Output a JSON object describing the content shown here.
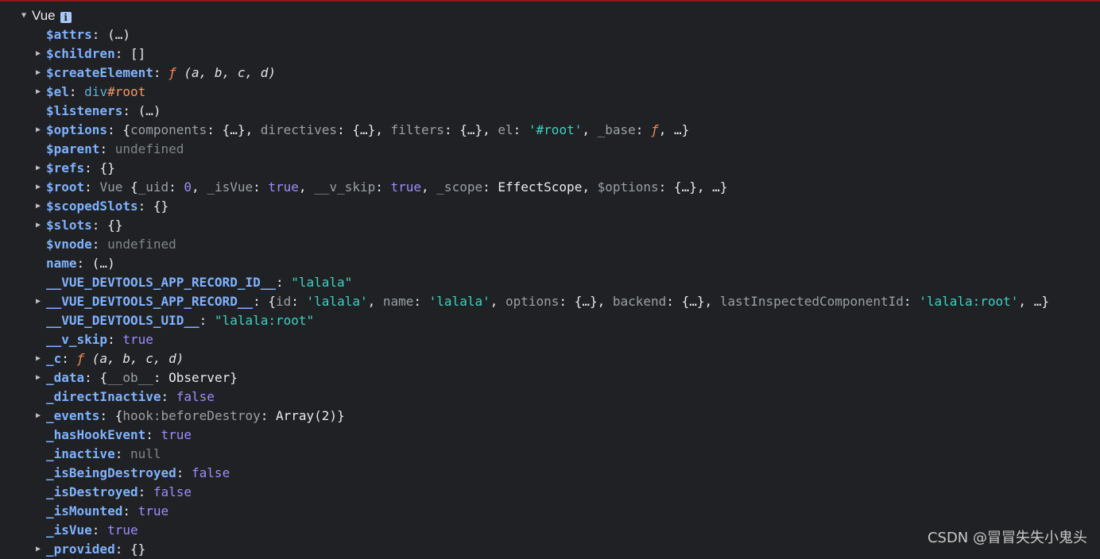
{
  "root": {
    "label": "Vue",
    "info_icon": "info-icon",
    "expanded": true
  },
  "rows": [
    {
      "key": "$attrs",
      "expandable": false,
      "value": [
        {
          "t": "(…)",
          "c": "plain"
        }
      ]
    },
    {
      "key": "$children",
      "expandable": true,
      "value": [
        {
          "t": "[]",
          "c": "plain"
        }
      ]
    },
    {
      "key": "$createElement",
      "expandable": true,
      "value": [
        {
          "t": "ƒ",
          "c": "fn"
        },
        {
          "t": " (a, b, c, d)",
          "c": "fn-args"
        }
      ]
    },
    {
      "key": "$el",
      "expandable": true,
      "value": [
        {
          "t": "div",
          "c": "html-tag"
        },
        {
          "t": "#root",
          "c": "html-attr"
        }
      ]
    },
    {
      "key": "$listeners",
      "expandable": false,
      "value": [
        {
          "t": "(…)",
          "c": "plain"
        }
      ]
    },
    {
      "key": "$options",
      "expandable": true,
      "value": [
        {
          "t": "{",
          "c": "plain"
        },
        {
          "t": "components",
          "c": "k"
        },
        {
          "t": ": {…}, ",
          "c": "plain"
        },
        {
          "t": "directives",
          "c": "k"
        },
        {
          "t": ": {…}, ",
          "c": "plain"
        },
        {
          "t": "filters",
          "c": "k"
        },
        {
          "t": ": {…}, ",
          "c": "plain"
        },
        {
          "t": "el",
          "c": "k"
        },
        {
          "t": ": ",
          "c": "plain"
        },
        {
          "t": "'#root'",
          "c": "str"
        },
        {
          "t": ", ",
          "c": "plain"
        },
        {
          "t": "_base",
          "c": "k"
        },
        {
          "t": ": ",
          "c": "plain"
        },
        {
          "t": "ƒ",
          "c": "fn"
        },
        {
          "t": ", …}",
          "c": "plain"
        }
      ]
    },
    {
      "key": "$parent",
      "expandable": false,
      "value": [
        {
          "t": "undefined",
          "c": "null"
        }
      ]
    },
    {
      "key": "$refs",
      "expandable": true,
      "value": [
        {
          "t": "{}",
          "c": "plain"
        }
      ]
    },
    {
      "key": "$root",
      "expandable": true,
      "value": [
        {
          "t": "Vue ",
          "c": "k"
        },
        {
          "t": "{",
          "c": "plain"
        },
        {
          "t": "_uid",
          "c": "k"
        },
        {
          "t": ": ",
          "c": "plain"
        },
        {
          "t": "0",
          "c": "num"
        },
        {
          "t": ", ",
          "c": "plain"
        },
        {
          "t": "_isVue",
          "c": "k"
        },
        {
          "t": ": ",
          "c": "plain"
        },
        {
          "t": "true",
          "c": "kw"
        },
        {
          "t": ", ",
          "c": "plain"
        },
        {
          "t": "__v_skip",
          "c": "k"
        },
        {
          "t": ": ",
          "c": "plain"
        },
        {
          "t": "true",
          "c": "kw"
        },
        {
          "t": ", ",
          "c": "plain"
        },
        {
          "t": "_scope",
          "c": "k"
        },
        {
          "t": ": EffectScope, ",
          "c": "plain"
        },
        {
          "t": "$options",
          "c": "k"
        },
        {
          "t": ": {…}, …}",
          "c": "plain"
        }
      ]
    },
    {
      "key": "$scopedSlots",
      "expandable": true,
      "value": [
        {
          "t": "{}",
          "c": "plain"
        }
      ]
    },
    {
      "key": "$slots",
      "expandable": true,
      "value": [
        {
          "t": "{}",
          "c": "plain"
        }
      ]
    },
    {
      "key": "$vnode",
      "expandable": false,
      "value": [
        {
          "t": "undefined",
          "c": "null"
        }
      ]
    },
    {
      "key": "name",
      "expandable": false,
      "value": [
        {
          "t": "(…)",
          "c": "plain"
        }
      ]
    },
    {
      "key": "__VUE_DEVTOOLS_APP_RECORD_ID__",
      "expandable": false,
      "value": [
        {
          "t": "\"lalala\"",
          "c": "str"
        }
      ]
    },
    {
      "key": "__VUE_DEVTOOLS_APP_RECORD__",
      "expandable": true,
      "value": [
        {
          "t": "{",
          "c": "plain"
        },
        {
          "t": "id",
          "c": "k"
        },
        {
          "t": ": ",
          "c": "plain"
        },
        {
          "t": "'lalala'",
          "c": "str"
        },
        {
          "t": ", ",
          "c": "plain"
        },
        {
          "t": "name",
          "c": "k"
        },
        {
          "t": ": ",
          "c": "plain"
        },
        {
          "t": "'lalala'",
          "c": "str"
        },
        {
          "t": ", ",
          "c": "plain"
        },
        {
          "t": "options",
          "c": "k"
        },
        {
          "t": ": {…}, ",
          "c": "plain"
        },
        {
          "t": "backend",
          "c": "k"
        },
        {
          "t": ": {…}, ",
          "c": "plain"
        },
        {
          "t": "lastInspectedComponentId",
          "c": "k"
        },
        {
          "t": ": ",
          "c": "plain"
        },
        {
          "t": "'lalala:root'",
          "c": "str"
        },
        {
          "t": ", …}",
          "c": "plain"
        }
      ]
    },
    {
      "key": "__VUE_DEVTOOLS_UID__",
      "expandable": false,
      "value": [
        {
          "t": "\"lalala:root\"",
          "c": "str"
        }
      ]
    },
    {
      "key": "__v_skip",
      "expandable": false,
      "value": [
        {
          "t": "true",
          "c": "kw"
        }
      ]
    },
    {
      "key": "_c",
      "expandable": true,
      "value": [
        {
          "t": "ƒ",
          "c": "fn"
        },
        {
          "t": " (a, b, c, d)",
          "c": "fn-args"
        }
      ]
    },
    {
      "key": "_data",
      "expandable": true,
      "value": [
        {
          "t": "{",
          "c": "plain"
        },
        {
          "t": "__ob__",
          "c": "k"
        },
        {
          "t": ": Observer}",
          "c": "plain"
        }
      ]
    },
    {
      "key": "_directInactive",
      "expandable": false,
      "value": [
        {
          "t": "false",
          "c": "kw"
        }
      ]
    },
    {
      "key": "_events",
      "expandable": true,
      "value": [
        {
          "t": "{",
          "c": "plain"
        },
        {
          "t": "hook:beforeDestroy",
          "c": "k"
        },
        {
          "t": ": Array(2)}",
          "c": "plain"
        }
      ]
    },
    {
      "key": "_hasHookEvent",
      "expandable": false,
      "value": [
        {
          "t": "true",
          "c": "kw"
        }
      ]
    },
    {
      "key": "_inactive",
      "expandable": false,
      "value": [
        {
          "t": "null",
          "c": "null"
        }
      ]
    },
    {
      "key": "_isBeingDestroyed",
      "expandable": false,
      "value": [
        {
          "t": "false",
          "c": "kw"
        }
      ]
    },
    {
      "key": "_isDestroyed",
      "expandable": false,
      "value": [
        {
          "t": "false",
          "c": "kw"
        }
      ]
    },
    {
      "key": "_isMounted",
      "expandable": false,
      "value": [
        {
          "t": "true",
          "c": "kw"
        }
      ]
    },
    {
      "key": "_isVue",
      "expandable": false,
      "value": [
        {
          "t": "true",
          "c": "kw"
        }
      ]
    },
    {
      "key": "_provided",
      "expandable": true,
      "value": [
        {
          "t": "{}",
          "c": "plain"
        }
      ]
    }
  ],
  "watermark": "CSDN @冒冒失失小鬼头"
}
